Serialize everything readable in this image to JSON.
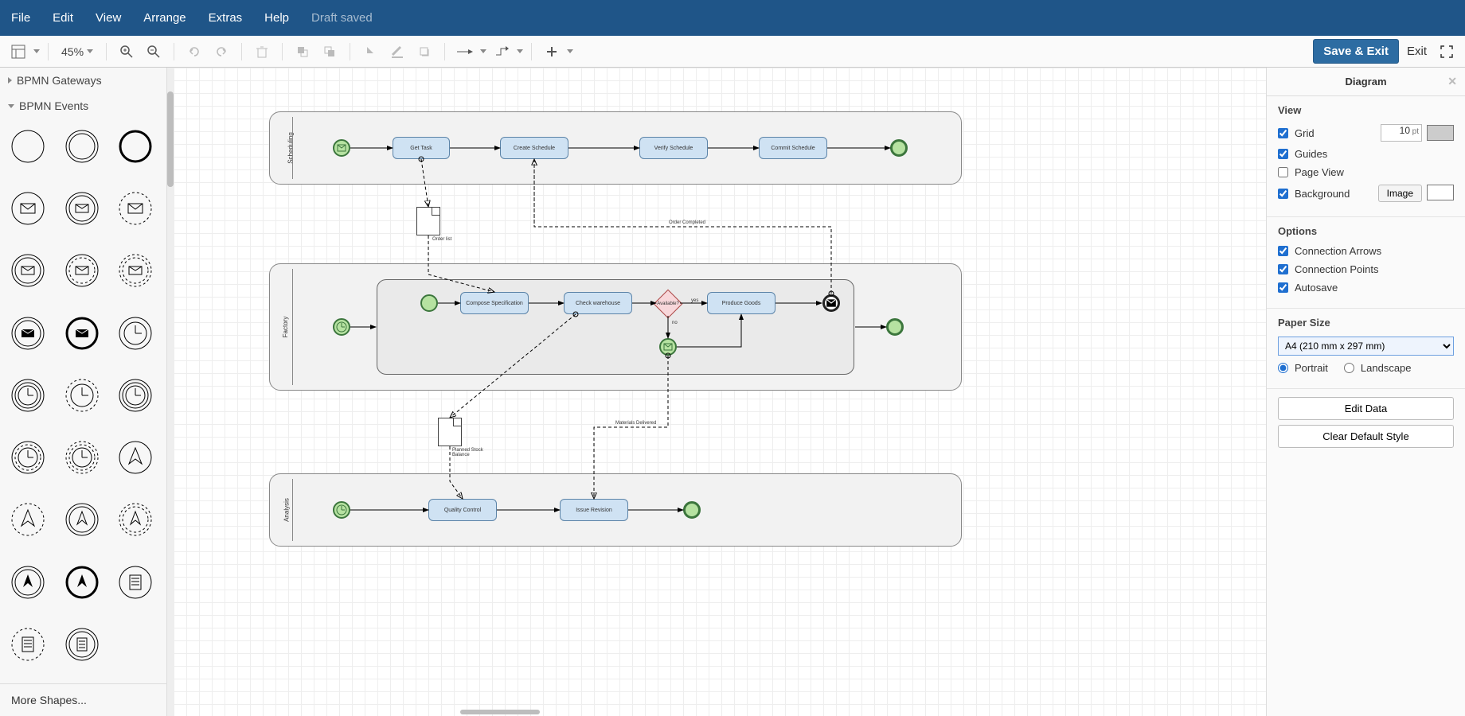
{
  "menubar": {
    "file": "File",
    "edit": "Edit",
    "view": "View",
    "arrange": "Arrange",
    "extras": "Extras",
    "help": "Help",
    "draft": "Draft saved"
  },
  "toolbar": {
    "zoom": "45%",
    "save_exit": "Save & Exit",
    "exit": "Exit"
  },
  "sidebar": {
    "cat_gateways": "BPMN Gateways",
    "cat_events": "BPMN Events",
    "more": "More Shapes..."
  },
  "diagram": {
    "pools": {
      "scheduling": {
        "title": "Scheduling",
        "tasks": {
          "get": "Get Task",
          "create": "Create Schedule",
          "verify": "Verify Schedule",
          "commit": "Commit Schedule"
        }
      },
      "factory": {
        "title": "Factory",
        "tasks": {
          "compose": "Compose Specification",
          "check": "Check warehouse",
          "produce": "Produce Goods"
        },
        "gateway": "Available?",
        "yes": "yes",
        "no": "no"
      },
      "analysis": {
        "title": "Analysis",
        "tasks": {
          "qc": "Quality Control",
          "issue": "Issue Revision"
        }
      }
    },
    "docs": {
      "order": "Order list",
      "stock": "Planned Stock Balance"
    },
    "msgs": {
      "order_completed": "Order Completed",
      "materials": "Materials Delivered"
    }
  },
  "right": {
    "title": "Diagram",
    "view": {
      "header": "View",
      "grid": "Grid",
      "grid_val": "10",
      "grid_unit": "pt",
      "guides": "Guides",
      "pageview": "Page View",
      "background": "Background",
      "image": "Image"
    },
    "options": {
      "header": "Options",
      "arrows": "Connection Arrows",
      "points": "Connection Points",
      "autosave": "Autosave"
    },
    "paper": {
      "header": "Paper Size",
      "size": "A4 (210 mm x 297 mm)",
      "portrait": "Portrait",
      "landscape": "Landscape"
    },
    "edit_data": "Edit Data",
    "clear_style": "Clear Default Style"
  },
  "chart_data": {
    "type": "bpmn-process",
    "pools": [
      {
        "name": "Scheduling",
        "elements": [
          {
            "id": "s_start",
            "type": "start-message"
          },
          {
            "id": "s_get",
            "type": "task",
            "label": "Get Task"
          },
          {
            "id": "s_create",
            "type": "task",
            "label": "Create Schedule"
          },
          {
            "id": "s_verify",
            "type": "task",
            "label": "Verify Schedule"
          },
          {
            "id": "s_commit",
            "type": "task",
            "label": "Commit Schedule"
          },
          {
            "id": "s_end",
            "type": "end"
          }
        ],
        "flows": [
          [
            "s_start",
            "s_get"
          ],
          [
            "s_get",
            "s_create"
          ],
          [
            "s_create",
            "s_verify"
          ],
          [
            "s_verify",
            "s_commit"
          ],
          [
            "s_commit",
            "s_end"
          ]
        ]
      },
      {
        "name": "Factory",
        "elements": [
          {
            "id": "f_start",
            "type": "start-timer"
          },
          {
            "id": "f_substart",
            "type": "start"
          },
          {
            "id": "f_compose",
            "type": "task",
            "label": "Compose Specification"
          },
          {
            "id": "f_check",
            "type": "task",
            "label": "Check warehouse"
          },
          {
            "id": "f_gw",
            "type": "exclusive-gateway",
            "label": "Available?"
          },
          {
            "id": "f_produce",
            "type": "task",
            "label": "Produce Goods"
          },
          {
            "id": "f_msg",
            "type": "intermediate-message"
          },
          {
            "id": "f_subend",
            "type": "end-terminate"
          },
          {
            "id": "f_end",
            "type": "end"
          }
        ],
        "flows": [
          [
            "f_start",
            "f_substart"
          ],
          [
            "f_substart",
            "f_compose"
          ],
          [
            "f_compose",
            "f_check"
          ],
          [
            "f_check",
            "f_gw"
          ],
          [
            "f_gw",
            "f_produce",
            "yes"
          ],
          [
            "f_gw",
            "f_msg",
            "no"
          ],
          [
            "f_msg",
            "f_produce"
          ],
          [
            "f_produce",
            "f_subend"
          ],
          [
            "f_subend",
            "f_end"
          ]
        ]
      },
      {
        "name": "Analysis",
        "elements": [
          {
            "id": "a_start",
            "type": "start-timer"
          },
          {
            "id": "a_qc",
            "type": "task",
            "label": "Quality Control"
          },
          {
            "id": "a_issue",
            "type": "task",
            "label": "Issue Revision"
          },
          {
            "id": "a_end",
            "type": "end"
          }
        ],
        "flows": [
          [
            "a_start",
            "a_qc"
          ],
          [
            "a_qc",
            "a_issue"
          ],
          [
            "a_issue",
            "a_end"
          ]
        ]
      }
    ],
    "message_flows": [
      {
        "label": "Order list",
        "from": "s_get",
        "to": "f_compose",
        "artifact": "document"
      },
      {
        "label": "Order Completed",
        "from": "f_subend",
        "to": "s_create"
      },
      {
        "label": "Planned Stock Balance",
        "from": "f_check",
        "to": "a_qc",
        "artifact": "document"
      },
      {
        "label": "Materials Delivered",
        "from": "a_issue",
        "to": "f_msg"
      }
    ]
  }
}
